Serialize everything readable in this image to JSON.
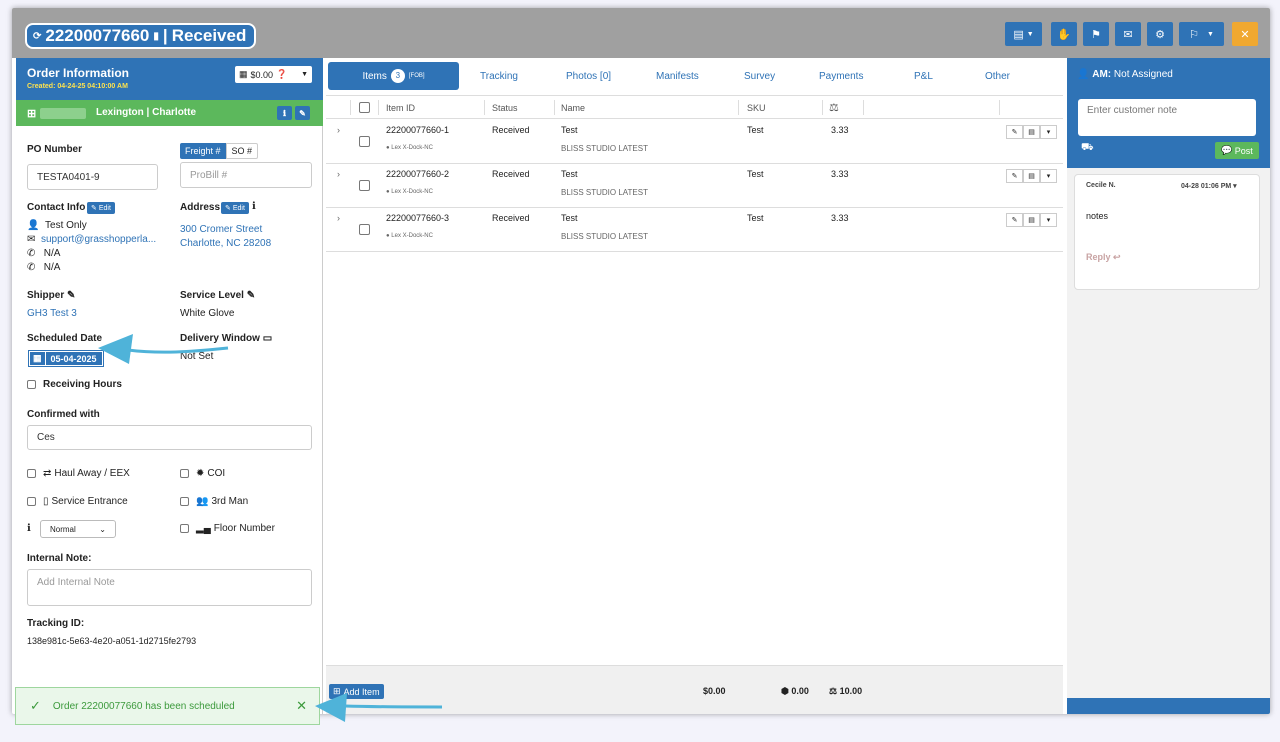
{
  "header": {
    "order_number": "22200077660",
    "status": "Received",
    "toolbar": [
      "document-menu",
      "hand",
      "flag",
      "email",
      "settings",
      "flag-menu",
      "close"
    ]
  },
  "order_info": {
    "title": "Order Information",
    "created": "Created: 04-24-25 04:10:00 AM",
    "amount": "$0.00",
    "location": "Lexington | Charlotte",
    "po_label": "PO Number",
    "po_value": "TESTA0401-9",
    "freight_label": "Freight #",
    "so_label": "SO #",
    "probill_placeholder": "ProBill #",
    "contact_label": "Contact Info",
    "edit_label": "Edit",
    "contact_name": "Test Only",
    "contact_email": "support@grasshopperla...",
    "phone1": "N/A",
    "phone2": "N/A",
    "address_label": "Address",
    "address_line1": "300 Cromer Street",
    "address_line2": "Charlotte, NC 28208",
    "shipper_label": "Shipper",
    "shipper_value": "GH3 Test 3",
    "service_label": "Service Level",
    "service_value": "White Glove",
    "scheduled_label": "Scheduled Date",
    "scheduled_value": "05-04-2025",
    "window_label": "Delivery Window",
    "window_value": "Not Set",
    "receiving_hours": "Receiving Hours",
    "confirmed_label": "Confirmed with",
    "confirmed_value": "Ces",
    "haul_away": "Haul Away / EEX",
    "coi": "COI",
    "service_entrance": "Service Entrance",
    "third_man": "3rd Man",
    "priority_value": "Normal",
    "floor_number": "Floor Number",
    "internal_note_label": "Internal Note:",
    "internal_note_placeholder": "Add Internal Note",
    "tracking_label": "Tracking ID:",
    "tracking_value": "138e981c-5e63-4e20-a051-1d2715fe2793"
  },
  "tabs": {
    "items": "Items",
    "items_count": "3",
    "items_tag": "[FOB]",
    "tracking": "Tracking",
    "photos": "Photos [0]",
    "manifests": "Manifests",
    "survey": "Survey",
    "payments": "Payments",
    "pl": "P&L",
    "other": "Other"
  },
  "table": {
    "headers": {
      "item_id": "Item ID",
      "status": "Status",
      "name": "Name",
      "sku": "SKU"
    },
    "rows": [
      {
        "id": "22200077660-1",
        "location": "Lex X-Dock-NC",
        "status": "Received",
        "name": "Test",
        "subname": "BLISS STUDIO LATEST",
        "sku": "Test",
        "weight": "3.33"
      },
      {
        "id": "22200077660-2",
        "location": "Lex X-Dock-NC",
        "status": "Received",
        "name": "Test",
        "subname": "BLISS STUDIO LATEST",
        "sku": "Test",
        "weight": "3.33"
      },
      {
        "id": "22200077660-3",
        "location": "Lex X-Dock-NC",
        "status": "Received",
        "name": "Test",
        "subname": "BLISS STUDIO LATEST",
        "sku": "Test",
        "weight": "3.33"
      }
    ],
    "add_item": "Add Item",
    "total_amount": "$0.00",
    "total_cube": "0.00",
    "total_weight": "10.00"
  },
  "notes": {
    "am_label": "AM:",
    "am_value": "Not Assigned",
    "placeholder": "Enter customer note",
    "post": "Post",
    "comment_user": "Cecile N.",
    "comment_time": "04-28 01:06 PM",
    "comment_text": "notes",
    "reply": "Reply"
  },
  "toast": {
    "message": "Order 22200077660 has been scheduled"
  },
  "colors": {
    "primary": "#2f73b6",
    "success": "#5cb85c",
    "warning": "#f0a830",
    "annotation_arrow": "#4fb3d9"
  }
}
